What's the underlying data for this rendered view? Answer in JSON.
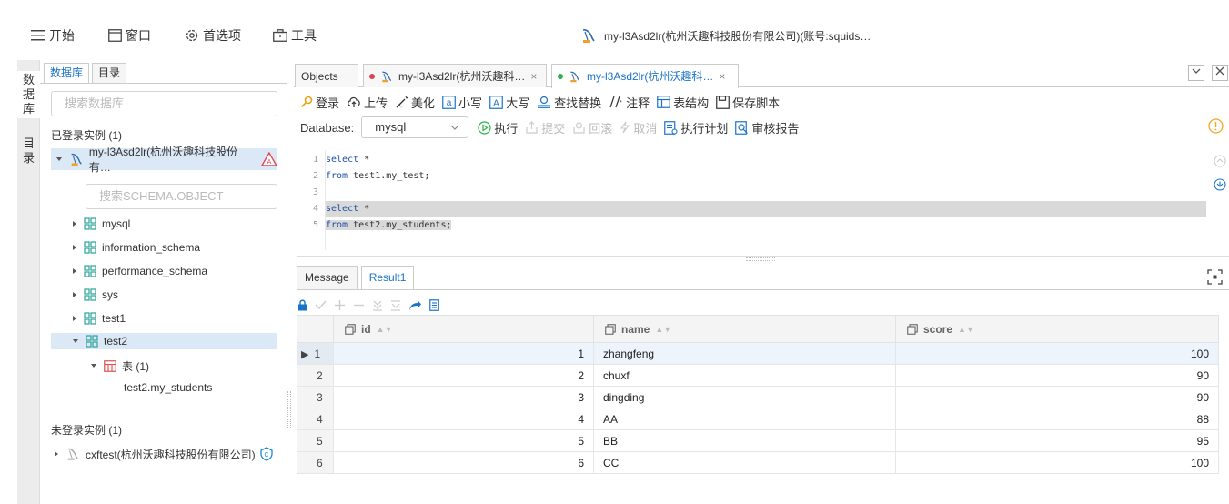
{
  "menu": {
    "start": "开始",
    "window": "窗口",
    "prefs": "首选项",
    "tools": "工具"
  },
  "window_title": "my-l3Asd2lr(杭州沃趣科技股份有限公司)(账号:squids…",
  "rail": {
    "database": "数据库",
    "catalog": "目录"
  },
  "sidebar": {
    "tabs": [
      "数据库",
      "目录"
    ],
    "search_placeholder": "搜索数据库",
    "logged_label": "已登录实例 (1)",
    "instance": "my-l3Asd2lr(杭州沃趣科技股份有…",
    "schema_placeholder": "搜索SCHEMA.OBJECT",
    "schemas": [
      "mysql",
      "information_schema",
      "performance_schema",
      "sys",
      "test1",
      "test2"
    ],
    "table_group": "表 (1)",
    "table_item": "test2.my_students",
    "unlogged_label": "未登录实例 (1)",
    "unlogged_instance": "cxftest(杭州沃趣科技股份有限公司)"
  },
  "editor": {
    "tabs": [
      {
        "label": "Objects"
      },
      {
        "label": "my-l3Asd2lr(杭州沃趣科…",
        "dot": "#e0424f"
      },
      {
        "label": "my-l3Asd2lr(杭州沃趣科…",
        "dot": "#2db34a"
      }
    ],
    "close_glyph": "×",
    "toolbar": [
      "登录",
      "上传",
      "美化",
      "小写",
      "大写",
      "查找替换",
      "注释",
      "表结构",
      "保存脚本"
    ],
    "database_label": "Database:",
    "database_value": "mysql",
    "actions": [
      "执行",
      "提交",
      "回滚",
      "取消",
      "执行计划",
      "审核报告"
    ],
    "code": [
      {
        "n": "1",
        "kw": "select",
        "rest": " *"
      },
      {
        "n": "2",
        "kw": "from",
        "rest": " test1.my_test;"
      },
      {
        "n": "3",
        "kw": "",
        "rest": ""
      },
      {
        "n": "4",
        "kw": "select",
        "rest": " *"
      },
      {
        "n": "5",
        "kw": "from",
        "rest": " test2.my_students;"
      }
    ]
  },
  "results": {
    "tabs": [
      "Message",
      "Result1"
    ],
    "columns": [
      "id",
      "name",
      "score"
    ],
    "rows": [
      {
        "rn": "1",
        "id": "1",
        "name": "zhangfeng",
        "score": "100"
      },
      {
        "rn": "2",
        "id": "2",
        "name": "chuxf",
        "score": "90"
      },
      {
        "rn": "3",
        "id": "3",
        "name": "dingding",
        "score": "90"
      },
      {
        "rn": "4",
        "id": "4",
        "name": "AA",
        "score": "88"
      },
      {
        "rn": "5",
        "id": "5",
        "name": "BB",
        "score": "95"
      },
      {
        "rn": "6",
        "id": "6",
        "name": "CC",
        "score": "100"
      }
    ]
  },
  "colors": {
    "accent": "#1a73c9",
    "selection": "#dbe8f6",
    "schema_icon": "#2aa39a",
    "warning": "#f5a623"
  }
}
